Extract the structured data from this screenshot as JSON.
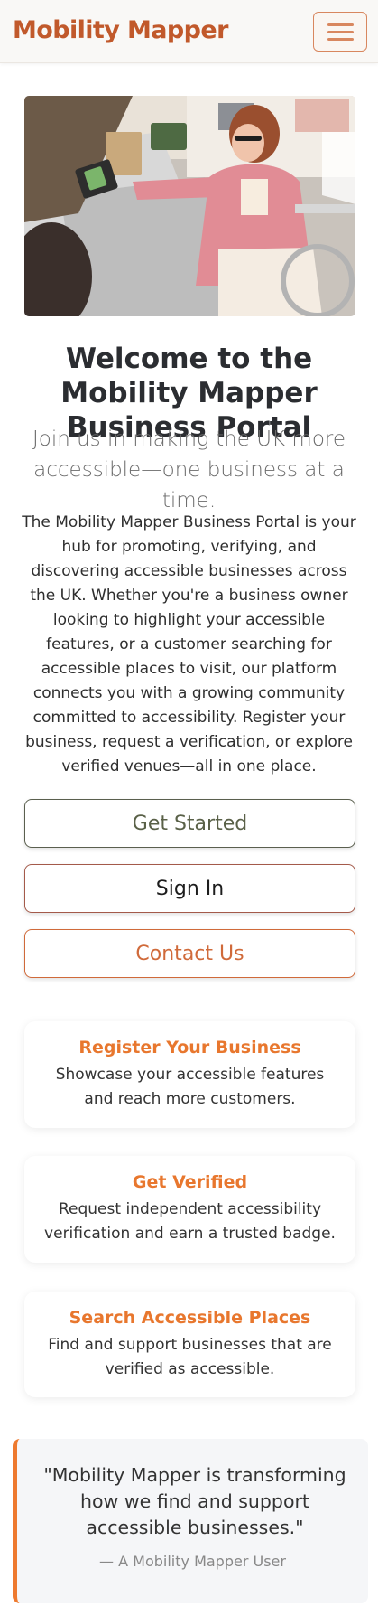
{
  "nav": {
    "brand": "Mobility Mapper",
    "menu_icon": "hamburger-menu-icon"
  },
  "hero": {
    "image_subject": "woman in wheelchair paying with phone at cafe counter"
  },
  "welcome": {
    "title": "Welcome to the Mobility Mapper Business Portal",
    "subtitle": "Join us in making the UK more accessible—one business at a time.",
    "intro": "The Mobility Mapper Business Portal is your hub for promoting, verifying, and discovering accessible businesses across the UK. Whether you're a business owner looking to highlight your accessible features, or a customer searching for accessible places to visit, our platform connects you with a growing community committed to accessibility. Register your business, request a verification, or explore verified venues—all in one place."
  },
  "actions": {
    "get_started": "Get Started",
    "sign_in": "Sign In",
    "contact_us": "Contact Us"
  },
  "features": [
    {
      "title": "Register Your Business",
      "text": "Showcase your accessible features and reach more customers."
    },
    {
      "title": "Get Verified",
      "text": "Request independent accessibility verification and earn a trusted badge."
    },
    {
      "title": "Search Accessible Places",
      "text": "Find and support businesses that are verified as accessible."
    }
  ],
  "testimonial": {
    "quote": "\"Mobility Mapper is transforming how we find and support accessible businesses.\"",
    "author": "— A Mobility Mapper User"
  },
  "colors": {
    "brand": "#c1592b",
    "accent": "#e8772e",
    "text": "#2f2f2f"
  }
}
